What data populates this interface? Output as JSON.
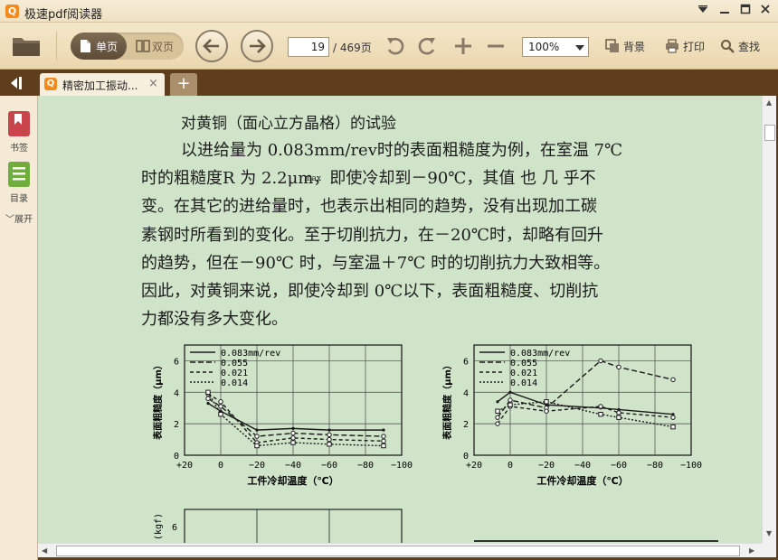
{
  "app": {
    "title": "极速pdf阅读器",
    "logo_char": "Q"
  },
  "toolbar": {
    "single_page": "单页",
    "double_page": "双页",
    "current_page": "19",
    "total_pages": "/ 469页",
    "zoom": "100%",
    "background": "背景",
    "print": "打印",
    "find": "查找"
  },
  "tabs": [
    {
      "label": "精密加工振动...",
      "close": "×"
    }
  ],
  "new_tab": "+",
  "sidebar": {
    "bookmarks": "书签",
    "toc": "目录",
    "expand": "展开"
  },
  "document": {
    "heading": "对黄铜（面心立方晶格）的试验",
    "lines": [
      "以进给量为 0.083mm/rev时的表面粗糙度为例，在室温 7℃",
      "时的粗糙度R  为 2.2μm，即使冷却到－90℃，其值 也 几 乎不",
      "变。在其它的进给量时，也表示出相同的趋势，没有出现加工碳",
      "素钢时所看到的变化。至于切削抗力，在－20℃时，却略有回升",
      "的趋势，但在－90℃ 时，与室温＋7℃ 时的切削抗力大致相等。",
      "因此，对黄铜来说，即使冷却到 0℃以下，表面粗糙度、切削抗",
      "力都没有多大变化。"
    ],
    "rmax_sub": "max"
  },
  "chart_data": [
    {
      "type": "line",
      "title": "",
      "xlabel": "工件冷却温度（℃）",
      "ylabel": "表面粗糙度（μm）",
      "xlim": [
        20,
        -100
      ],
      "ylim": [
        0,
        7
      ],
      "xticks": [
        "+20",
        "0",
        "−20",
        "−40",
        "−60",
        "−80",
        "−100"
      ],
      "yticks": [
        "0",
        "2",
        "4",
        "6"
      ],
      "legend_position": "top-left",
      "grid": true,
      "series": [
        {
          "name": "0.083mm/rev",
          "x": [
            7,
            0,
            -20,
            -40,
            -60,
            -90
          ],
          "y": [
            3.3,
            2.8,
            1.6,
            1.7,
            1.6,
            1.6
          ]
        },
        {
          "name": "0.055",
          "x": [
            7,
            0,
            -20,
            -40,
            -60,
            -90
          ],
          "y": [
            3.6,
            3.1,
            1.2,
            1.4,
            1.3,
            1.2
          ]
        },
        {
          "name": "0.021",
          "x": [
            7,
            0,
            -20,
            -40,
            -60,
            -90
          ],
          "y": [
            3.9,
            3.4,
            0.8,
            1.1,
            1.0,
            0.9
          ]
        },
        {
          "name": "0.014",
          "x": [
            7,
            0,
            -20,
            -40,
            -60,
            -90
          ],
          "y": [
            4.0,
            2.6,
            0.6,
            0.8,
            0.7,
            0.6
          ]
        }
      ]
    },
    {
      "type": "line",
      "title": "",
      "xlabel": "工件冷却温度（℃）",
      "ylabel": "表面粗糙度（μm）",
      "xlim": [
        20,
        -100
      ],
      "ylim": [
        0,
        7
      ],
      "xticks": [
        "+20",
        "0",
        "−20",
        "−40",
        "−60",
        "−80",
        "−100"
      ],
      "yticks": [
        "0",
        "2",
        "4",
        "6"
      ],
      "legend_position": "top-left",
      "grid": true,
      "series": [
        {
          "name": "0.083mm/rev",
          "x": [
            7,
            0,
            -20,
            -50,
            -60,
            -90
          ],
          "y": [
            3.4,
            4.0,
            3.2,
            3.0,
            2.9,
            2.6
          ]
        },
        {
          "name": "0.055",
          "x": [
            7,
            0,
            -20,
            -50,
            -60,
            -90
          ],
          "y": [
            2.4,
            3.5,
            3.0,
            6.0,
            5.6,
            4.8
          ]
        },
        {
          "name": "0.021",
          "x": [
            7,
            0,
            -20,
            -50,
            -60,
            -90
          ],
          "y": [
            2.0,
            3.1,
            2.8,
            3.1,
            2.7,
            2.4
          ]
        },
        {
          "name": "0.014",
          "x": [
            7,
            0,
            -20,
            -50,
            -60,
            -90
          ],
          "y": [
            2.8,
            3.2,
            3.4,
            2.6,
            2.4,
            1.8
          ]
        }
      ]
    }
  ],
  "partial_chart": {
    "ylabel": "(kgf)",
    "ytick": "6"
  }
}
